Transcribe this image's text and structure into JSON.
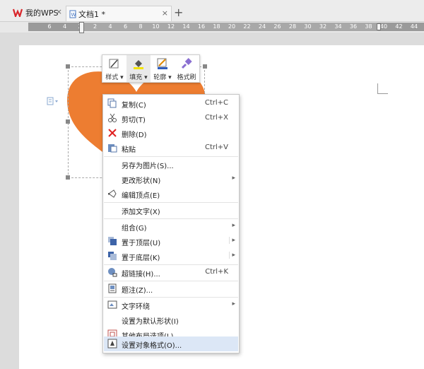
{
  "tabs": {
    "wps": "我的WPS",
    "doc": "文档1 *",
    "close": "×",
    "new": "+"
  },
  "ruler": {
    "ticks": [
      "6",
      "4",
      "2",
      "2",
      "4",
      "6",
      "8",
      "10",
      "12",
      "14",
      "16",
      "18",
      "20",
      "22",
      "24",
      "26",
      "28",
      "30",
      "32",
      "34",
      "36",
      "38",
      "40",
      "42",
      "44"
    ]
  },
  "minitoolbar": {
    "style": "样式",
    "fill": "填充",
    "outline": "轮廓",
    "format_painter": "格式刷"
  },
  "shape": {
    "fill_color": "#ed7d31"
  },
  "menu": {
    "copy": {
      "label": "复制(C)",
      "shortcut": "Ctrl+C"
    },
    "cut": {
      "label": "剪切(T)",
      "shortcut": "Ctrl+X"
    },
    "delete": {
      "label": "删除(D)"
    },
    "paste": {
      "label": "粘贴",
      "shortcut": "Ctrl+V"
    },
    "save_as_image": {
      "label": "另存为图片(S)..."
    },
    "change_shape": {
      "label": "更改形状(N)"
    },
    "edit_points": {
      "label": "编辑顶点(E)"
    },
    "add_text": {
      "label": "添加文字(X)"
    },
    "group": {
      "label": "组合(G)"
    },
    "bring_front": {
      "label": "置于顶层(U)"
    },
    "send_back": {
      "label": "置于底层(K)"
    },
    "hyperlink": {
      "label": "超链接(H)...",
      "shortcut": "Ctrl+K"
    },
    "caption": {
      "label": "题注(Z)..."
    },
    "text_wrap": {
      "label": "文字环绕"
    },
    "set_default": {
      "label": "设置为默认形状(I)"
    },
    "more_layout": {
      "label": "其他布局选项(L)..."
    },
    "format_object": {
      "label": "设置对象格式(O)..."
    }
  }
}
